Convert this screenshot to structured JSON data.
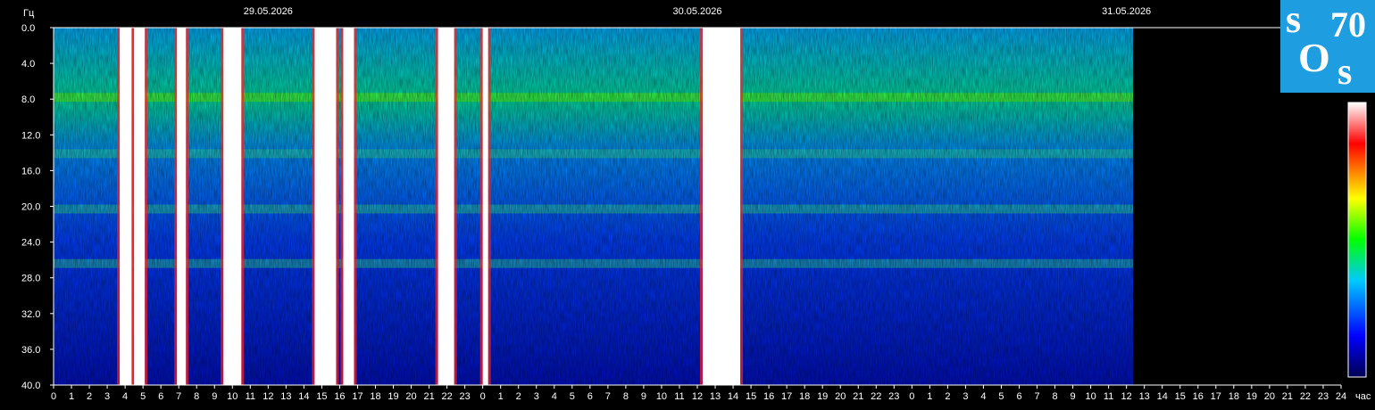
{
  "chart_data": {
    "type": "heatmap",
    "title": "",
    "ylabel": "Гц",
    "xlabel": "час",
    "ylim": [
      0,
      40
    ],
    "y_ticks": [
      "0.0",
      "4.0",
      "8.0",
      "12.0",
      "16.0",
      "20.0",
      "24.0",
      "28.0",
      "32.0",
      "36.0",
      "40.0"
    ],
    "x_ticks": [
      "0",
      "1",
      "2",
      "3",
      "4",
      "5",
      "6",
      "7",
      "8",
      "9",
      "10",
      "11",
      "12",
      "13",
      "14",
      "15",
      "16",
      "17",
      "18",
      "19",
      "20",
      "21",
      "22",
      "23",
      "0",
      "1",
      "2",
      "3",
      "4",
      "5",
      "6",
      "7",
      "8",
      "9",
      "10",
      "11",
      "12",
      "13",
      "14",
      "15",
      "16",
      "17",
      "18",
      "19",
      "20",
      "21",
      "22",
      "23",
      "0",
      "1",
      "2",
      "3",
      "4",
      "5",
      "6",
      "7",
      "8",
      "9",
      "10",
      "11",
      "12",
      "13",
      "14",
      "15",
      "16",
      "17",
      "18",
      "19",
      "20",
      "21",
      "22",
      "23",
      "24"
    ],
    "dates": [
      "29.05.2026",
      "30.05.2026",
      "31.05.2026"
    ],
    "data_end_hours": 60.5,
    "resonance_bands_hz": [
      7.8,
      14.1,
      20.3,
      26.4
    ],
    "saturated_intervals_hours": [
      [
        3.7,
        4.4
      ],
      [
        4.5,
        5.1
      ],
      [
        6.9,
        7.4
      ],
      [
        9.5,
        10.5
      ],
      [
        14.6,
        15.8
      ],
      [
        16.2,
        16.8
      ],
      [
        21.5,
        22.4
      ],
      [
        24.0,
        24.3
      ],
      [
        36.3,
        38.4
      ]
    ],
    "colormap": [
      "#000050",
      "#0000ff",
      "#00c8ff",
      "#00ff00",
      "#ffff00",
      "#ff0000",
      "#ffffff"
    ],
    "grid": false,
    "legend": "colorbar-right"
  },
  "logo": {
    "s1": "s",
    "n1": "70",
    "o": "O",
    "s2": "s"
  }
}
